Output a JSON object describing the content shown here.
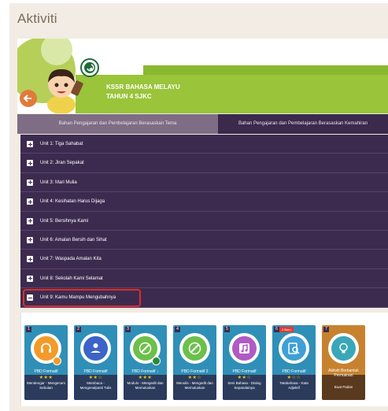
{
  "page": {
    "title": "Aktiviti"
  },
  "banner": {
    "subject_line1": "KSSR BAHASA MELAYU",
    "subject_line2": "TAHUN 4 SJKC"
  },
  "tabs": [
    {
      "label": "Bahan Pengajaran dan Pembelajaran Berasaskan Tema",
      "active": true
    },
    {
      "label": "Bahan Pengajaran dan Pembelajaran Berasaskan Kemahiran",
      "active": false
    }
  ],
  "units": [
    {
      "label": "Unit 1: Tiga Sahabat",
      "expanded": false
    },
    {
      "label": "Unit 2: Jiran Sepakat",
      "expanded": false
    },
    {
      "label": "Unit 3: Mari Mulia",
      "expanded": false
    },
    {
      "label": "Unit 4: Kesihatan Harus Dijaga",
      "expanded": false
    },
    {
      "label": "Unit 5: Bersihnya Kami",
      "expanded": false
    },
    {
      "label": "Unit 6: Amalan Bersih dan Sihat",
      "expanded": false
    },
    {
      "label": "Unit 7: Waspada Amalan Kita",
      "expanded": false
    },
    {
      "label": "Unit 8: Sekolah Kami Selamat",
      "expanded": false
    },
    {
      "label": "Unit 9: Kamu Mampu Mengubahnya",
      "expanded": true
    }
  ],
  "cards": [
    {
      "number": "1",
      "type": "PBD Formatif",
      "stars": "★★★",
      "title": "Mendengar - Mengecam Sebutan",
      "icon": "headphones-icon",
      "accent": "#f39a2a",
      "sub_icon_color": "#f39a2a"
    },
    {
      "number": "2",
      "type": "PBD Formatif",
      "stars": "★★☆",
      "title": "Membaca - Mengenalpasti Tulis",
      "icon": "reading-icon",
      "accent": "#3b63c9"
    },
    {
      "number": "3",
      "type": "PBD Formatif ↓",
      "stars": "★★★",
      "title": "Modulo - Mengedit dan Memutuskan",
      "icon": "edit-icon",
      "accent": "#6cc04a",
      "sub_icon_color": "#2f8fb7"
    },
    {
      "number": "4",
      "type": "PBD Formatif 2",
      "stars": "★★☆",
      "title": "Menulis - Mengedit dan Memutuskan",
      "icon": "edit-icon",
      "accent": "#6cc04a"
    },
    {
      "number": "5",
      "type": "PBD Formatif",
      "stars": "★★☆",
      "title": "Seni Bahasa - Dialog Sepandainya",
      "icon": "music-icon",
      "accent": "#b05ac4"
    },
    {
      "number": "6",
      "new_badge": "2 Baru",
      "type": "PBD Formatif",
      "stars": "★☆☆",
      "title": "Tatabahasa - Kata Adjektif",
      "icon": "search-doc-icon",
      "accent": "#3fa0d6"
    },
    {
      "number": "7",
      "type": "Aktiviti Berbantuk Permainan",
      "stars": "",
      "title": "Buat Padan",
      "icon": "lightbulb-icon",
      "accent": "#3aa7b8",
      "card_color": "#c7822f"
    }
  ],
  "colors": {
    "unit_bg": "#3d2b4f",
    "tab_active": "#7e6d84",
    "highlight": "#e02b2b"
  }
}
